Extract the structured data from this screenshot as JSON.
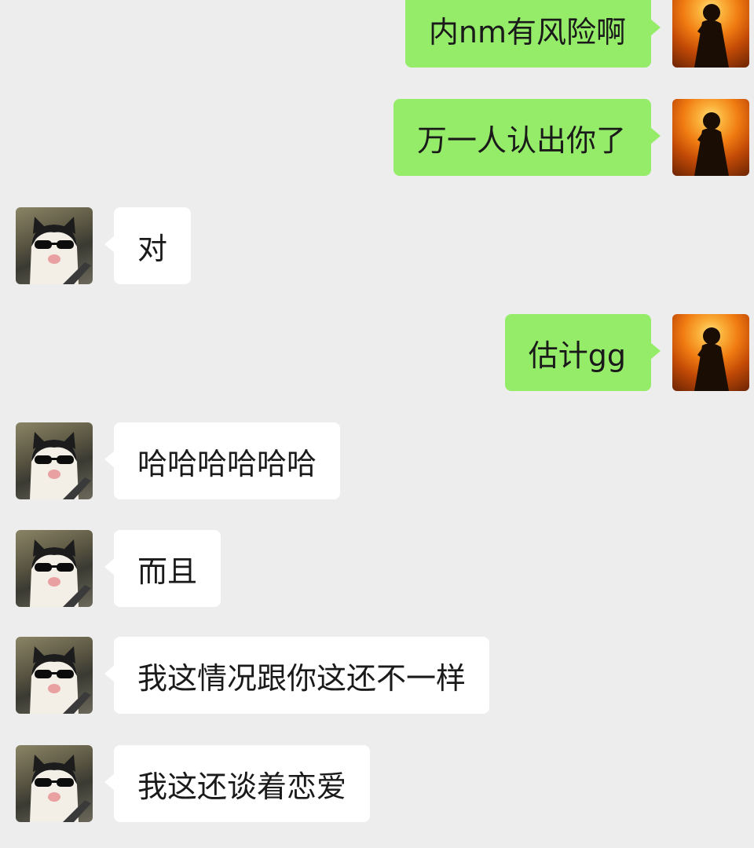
{
  "messages": [
    {
      "side": "self",
      "text": "内nm有风险啊",
      "avatar": "silhouette-sunset-avatar"
    },
    {
      "side": "self",
      "text": "万一人认出你了",
      "avatar": "silhouette-sunset-avatar"
    },
    {
      "side": "peer",
      "text": "对",
      "avatar": "sunglasses-cat-avatar"
    },
    {
      "side": "self",
      "text": "估计gg",
      "avatar": "silhouette-sunset-avatar"
    },
    {
      "side": "peer",
      "text": "哈哈哈哈哈哈",
      "avatar": "sunglasses-cat-avatar"
    },
    {
      "side": "peer",
      "text": "而且",
      "avatar": "sunglasses-cat-avatar"
    },
    {
      "side": "peer",
      "text": "我这情况跟你这还不一样",
      "avatar": "sunglasses-cat-avatar"
    },
    {
      "side": "peer",
      "text": "我这还谈着恋爱",
      "avatar": "sunglasses-cat-avatar"
    }
  ],
  "colors": {
    "background": "#ededed",
    "self_bubble": "#95ec69",
    "peer_bubble": "#ffffff",
    "text": "#1a1a1a"
  }
}
